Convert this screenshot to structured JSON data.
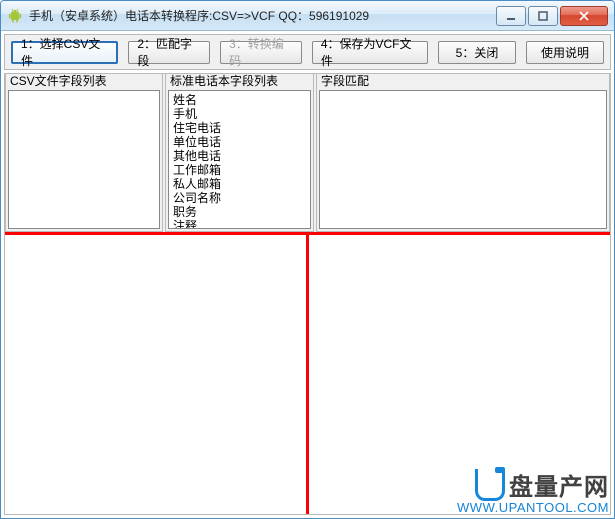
{
  "window": {
    "title": "手机（安卓系统）电话本转换程序:CSV=>VCF     QQ：596191029"
  },
  "toolbar": {
    "btn1": "1：选择CSV文件",
    "btn2": "2：匹配字段",
    "btn3": "3：转换编码",
    "btn4": "4：保存为VCF文件",
    "btn5": "5：关闭",
    "btn6": "使用说明"
  },
  "panels": {
    "csv_fields": {
      "title": "CSV文件字段列表"
    },
    "std_fields": {
      "title": "标准电话本字段列表",
      "items": [
        "姓名",
        "手机",
        "住宅电话",
        "单位电话",
        "其他电话",
        "工作邮箱",
        "私人邮箱",
        "公司名称",
        "职务",
        "注释"
      ]
    },
    "mapping": {
      "title": "字段匹配"
    }
  },
  "watermark": {
    "line1": "盘量产网",
    "line2": "WWW.UPANTOOL.COM"
  }
}
